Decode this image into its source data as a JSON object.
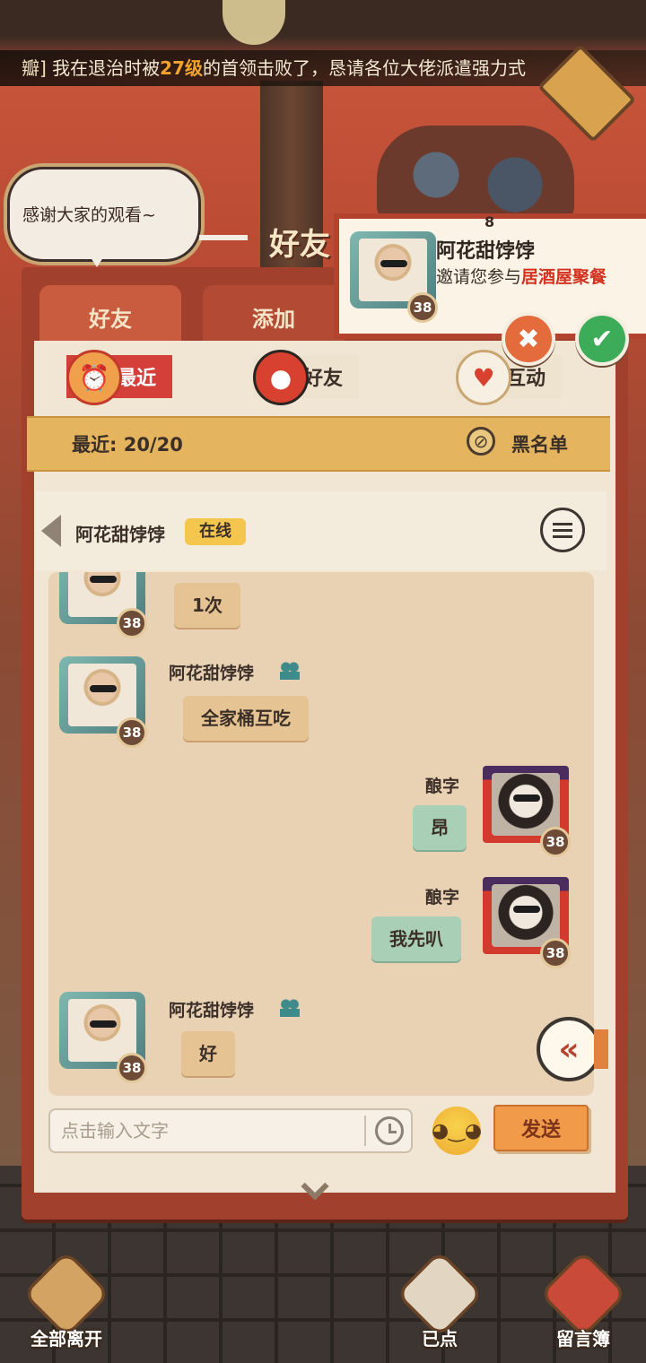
{
  "marquee": {
    "prefix": "瓣]",
    "text_before": " 我在退治时被",
    "level_highlight": "27级",
    "text_after": "的首领击败了，恳请各位大佬派遣强力式"
  },
  "speech_bubble": {
    "text": "感谢大家的观看~"
  },
  "title_deco": "好友",
  "invite": {
    "count": "8",
    "name": "阿花甜饽饽",
    "message_prefix": "邀请您参与",
    "message_highlight": "居酒屋聚餐",
    "level": "38"
  },
  "top_tabs": {
    "friends": "好友",
    "add": "添加"
  },
  "sub_tabs": {
    "recent": "最近",
    "friends": "好友",
    "interact": "互动"
  },
  "recent_bar": {
    "recent_count": "最近: 20/20",
    "blacklist": "黑名单"
  },
  "chat_header": {
    "name": "阿花甜饽饽",
    "status": "在线"
  },
  "messages": [
    {
      "sender": "",
      "text": "1次",
      "level": "38"
    },
    {
      "sender": "阿花甜饽饽",
      "text": "全家桶互吃",
      "level": "38"
    },
    {
      "sender": "酿字",
      "text": "昂",
      "level": "38"
    },
    {
      "sender": "酿字",
      "text": "我先叭",
      "level": "38"
    },
    {
      "sender": "阿花甜饽饽",
      "text": "好",
      "level": "38"
    }
  ],
  "input": {
    "placeholder": "点击输入文字",
    "send_label": "发送"
  },
  "bottom": {
    "leave_all": "全部离开",
    "ordered": "已点",
    "guestbook": "留言簿"
  },
  "colors": {
    "accent_red": "#d43f3a",
    "panel_red": "#a1402d",
    "bubble_incoming": "#e6c393",
    "bubble_outgoing": "#a9cfb6",
    "send_orange": "#f19a4a",
    "online_yellow": "#f5c64d"
  },
  "icons": {
    "reject": "close-icon",
    "accept": "check-icon",
    "recent": "alarm-clock-icon",
    "friends": "daruma-icon",
    "interact": "gift-doll-icon",
    "blacklist": "block-icon",
    "back": "chevron-left-icon",
    "menu": "menu-icon",
    "collapse": "double-chevron-left-icon",
    "history": "clock-icon",
    "emoji": "emoji-icon"
  }
}
